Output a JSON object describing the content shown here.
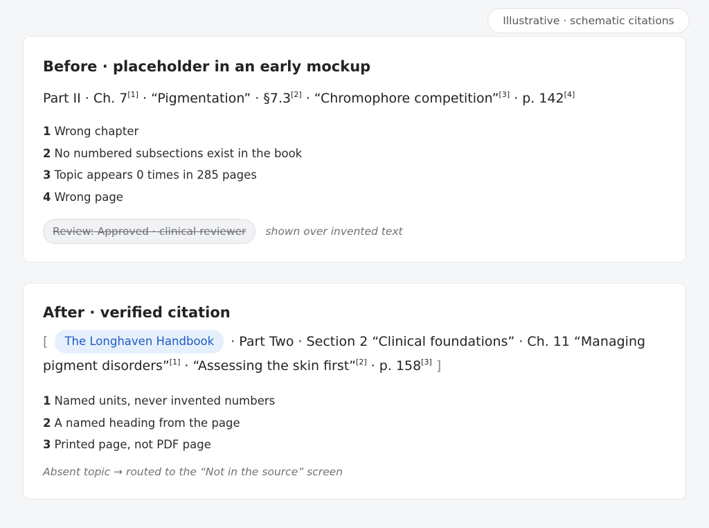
{
  "header": {
    "badge": "Illustrative · schematic citations"
  },
  "before": {
    "title": "Before · placeholder in an early mockup",
    "citation": {
      "part": "Part II · Ch. 7",
      "ref1": "[1]",
      "sep1": " · “Pigmentation” · §7.3",
      "ref2": "[2]",
      "sep2": " · “Chromophore competition”",
      "ref3": "[3]",
      "sep3": " · p. 142",
      "ref4": "[4]"
    },
    "notes": [
      {
        "num": "1",
        "text": "Wrong chapter"
      },
      {
        "num": "2",
        "text": "No numbered subsections exist in the book"
      },
      {
        "num": "3",
        "text": "Topic appears 0 times in 285 pages"
      },
      {
        "num": "4",
        "text": "Wrong page"
      }
    ],
    "review_chip": "Review: Approved · clinical reviewer",
    "review_note": "shown over invented text"
  },
  "after": {
    "title": "After · verified citation",
    "citation": {
      "open_bracket": "[",
      "book": "The Longhaven Handbook",
      "text1": " · Part Two · Section 2 “Clinical foundations” · Ch. 11 “Managing pigment disorders”",
      "ref1": "[1]",
      "text2": " · “Assessing the skin first”",
      "ref2": "[2]",
      "text3": " · p. 158",
      "ref3": "[3]",
      "close_bracket": "]"
    },
    "notes": [
      {
        "num": "1",
        "text": "Named units, never invented numbers"
      },
      {
        "num": "2",
        "text": "A named heading from the page"
      },
      {
        "num": "3",
        "text": "Printed page, not PDF page"
      }
    ],
    "footnote": "Absent topic → routed to the “Not in the source” screen"
  },
  "colors": {
    "background": "#f5f6f8",
    "card": "#ffffff",
    "text": "#222326",
    "muted": "#6f7177",
    "book_chip_bg": "#e6f0fd",
    "book_chip_text": "#1f5cbf",
    "review_chip_bg": "#f1f2f4"
  }
}
